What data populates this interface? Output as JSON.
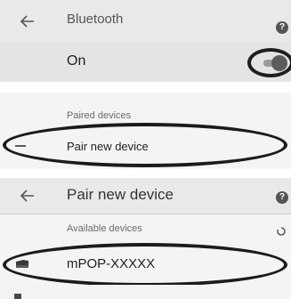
{
  "bluetooth_screen": {
    "title": "Bluetooth",
    "toggle_label": "On",
    "toggle_state": "on",
    "paired_devices_header": "Paired devices",
    "pair_new_device_label": "Pair new device"
  },
  "pair_screen": {
    "title": "Pair new device",
    "available_devices_header": "Available devices",
    "device_name": "mPOP-XXXXX"
  },
  "icons": {
    "back": "back-arrow-icon",
    "help": "help-icon",
    "add": "plus-icon",
    "device": "printer-device-icon",
    "refresh": "spinner-icon"
  },
  "help_glyph": "?",
  "colors": {
    "appbar": "#e9e9e9",
    "toggle_row": "#e4e4e4",
    "highlight_ring": "#1b1b1b"
  }
}
